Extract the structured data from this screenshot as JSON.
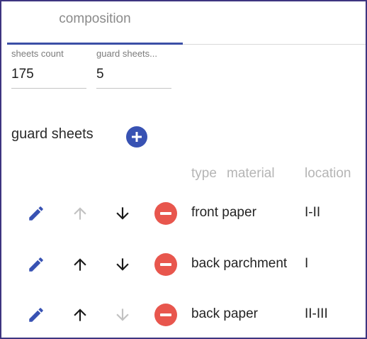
{
  "tabs": [
    {
      "label": "composition",
      "active": true
    }
  ],
  "fields": {
    "sheets_count": {
      "label": "sheets count",
      "value": "175"
    },
    "guard_sheets": {
      "label": "guard sheets...",
      "value": "5"
    }
  },
  "section": {
    "title": "guard sheets"
  },
  "columns": {
    "type": "type",
    "material": "material",
    "location": "location"
  },
  "rows": [
    {
      "type_material": "front paper",
      "location": "I-II",
      "up_enabled": false,
      "down_enabled": true
    },
    {
      "type_material": "back parchment",
      "location": "I",
      "up_enabled": true,
      "down_enabled": true
    },
    {
      "type_material": "back paper",
      "location": "II-III",
      "up_enabled": true,
      "down_enabled": false
    }
  ],
  "icons": {
    "edit": "pencil-icon",
    "up": "arrow-up-icon",
    "down": "arrow-down-icon",
    "remove": "minus-circle-icon",
    "add": "plus-circle-icon"
  },
  "colors": {
    "accent": "#3852b3",
    "tab_indicator": "#3b4fa6",
    "remove": "#e8564d",
    "frame_border": "#3d3580",
    "disabled": "#c2c2c2",
    "enabled": "#1a1a1a"
  }
}
